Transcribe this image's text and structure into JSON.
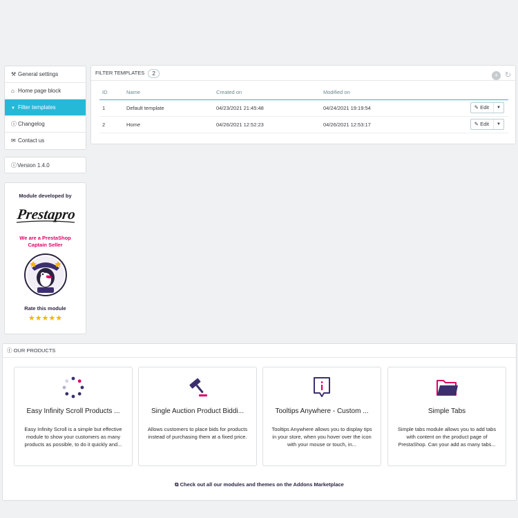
{
  "sidebar": {
    "items": [
      {
        "icon": "wrench-icon",
        "glyph": "⚒",
        "label": "General settings",
        "active": false
      },
      {
        "icon": "home-icon",
        "glyph": "⌂",
        "label": "Home page block",
        "active": false
      },
      {
        "icon": "filter-icon",
        "glyph": "▼",
        "label": "Filter templates",
        "active": true
      },
      {
        "icon": "info-icon",
        "glyph": "ⓘ",
        "label": "Changelog",
        "active": false
      },
      {
        "icon": "envelope-icon",
        "glyph": "✉",
        "label": "Contact us",
        "active": false
      }
    ],
    "version_label": "Version 1.4.0"
  },
  "promo": {
    "developed_by": "Module developed by",
    "logo_text": "Prestapro",
    "captain_line1": "We are a PrestaShop",
    "captain_line2": "Captain Seller",
    "rate_label": "Rate this module",
    "stars": "★★★★★"
  },
  "filters": {
    "title": "Filter templates",
    "count": "2",
    "columns": {
      "id": "ID",
      "name": "Name",
      "created": "Created on",
      "modified": "Modified on"
    },
    "rows": [
      {
        "id": "1",
        "name": "Default template",
        "created": "04/23/2021 21:45:48",
        "modified": "04/24/2021 19:19:54",
        "action": "Edit"
      },
      {
        "id": "2",
        "name": "Home",
        "created": "04/26/2021 12:52:23",
        "modified": "04/26/2021 12:53:17",
        "action": "Edit"
      }
    ]
  },
  "products": {
    "title": "Our products",
    "cards": [
      {
        "icon": "spinner-icon",
        "title": "Easy Infinity Scroll Products ...",
        "desc": "Easy Infinity Scroll is a simple but effective module to show your customers as many products as possible, to do it quickly and..."
      },
      {
        "icon": "gavel-icon",
        "title": "Single Auction Product Biddi...",
        "desc": "Allows customers to place bids for products instead of purchasing them at a fixed price."
      },
      {
        "icon": "tooltip-icon",
        "title": "Tooltips Anywhere - Custom ...",
        "desc": "Tooltips Anywhere allows you to display tips in your store, when you hover over the icon with your mouse or touch, in..."
      },
      {
        "icon": "folder-icon",
        "title": "Simple Tabs",
        "desc": "Simple tabs module allows you to add tabs with content on the product page of PrestaShop. Can your add as many tabs..."
      }
    ],
    "more_link": "Check out all our modules and themes on the Addons Marketplace"
  },
  "colors": {
    "accent": "#25b9d7",
    "brand_pink": "#df0067",
    "brand_navy": "#2b2440",
    "star": "#f5b400"
  }
}
